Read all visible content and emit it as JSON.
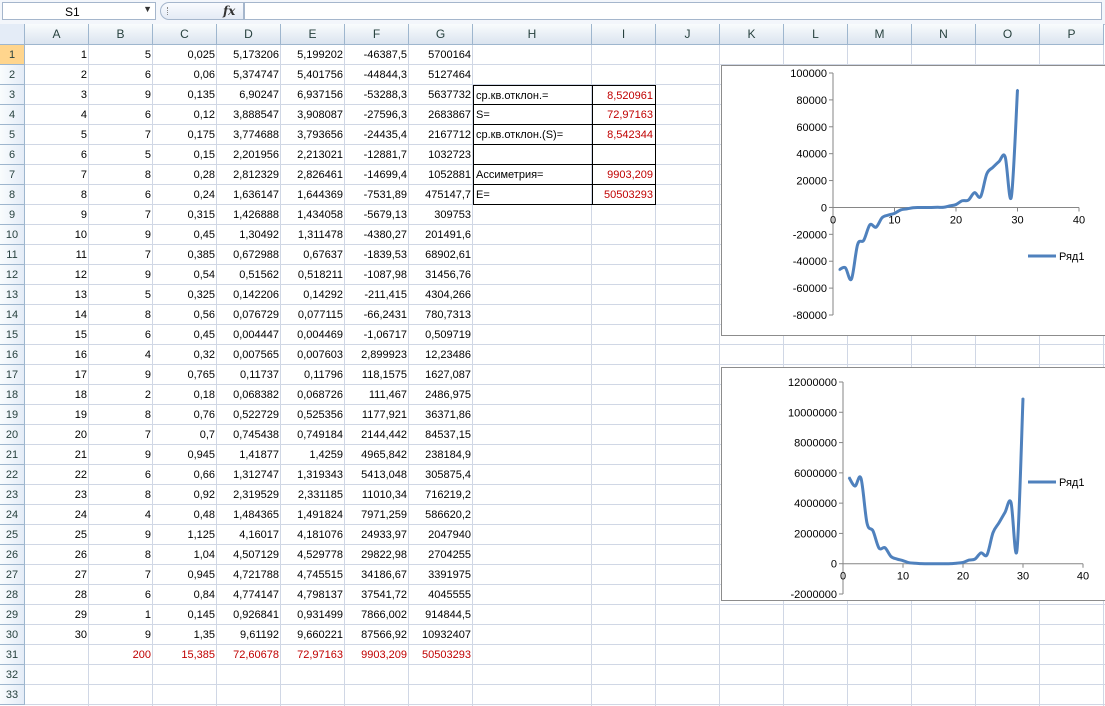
{
  "name_box": {
    "value": "S1"
  },
  "formula_bar": {
    "fx_label": "fx",
    "content": ""
  },
  "columns": [
    "A",
    "B",
    "C",
    "D",
    "E",
    "F",
    "G",
    "H",
    "I",
    "J",
    "K",
    "L",
    "M",
    "N",
    "O",
    "P"
  ],
  "rows": [
    "1",
    "2",
    "3",
    "4",
    "5",
    "6",
    "7",
    "8",
    "9",
    "10",
    "11",
    "12",
    "13",
    "14",
    "15",
    "16",
    "17",
    "18",
    "19",
    "20",
    "21",
    "22",
    "23",
    "24",
    "25",
    "26",
    "27",
    "28",
    "29",
    "30",
    "31",
    "32",
    "33"
  ],
  "table": [
    [
      "1",
      "5",
      "0,025",
      "5,173206",
      "5,199202",
      "-46387,5",
      "5700164"
    ],
    [
      "2",
      "6",
      "0,06",
      "5,374747",
      "5,401756",
      "-44844,3",
      "5127464"
    ],
    [
      "3",
      "9",
      "0,135",
      "6,90247",
      "6,937156",
      "-53288,3",
      "5637732"
    ],
    [
      "4",
      "6",
      "0,12",
      "3,888547",
      "3,908087",
      "-27596,3",
      "2683867"
    ],
    [
      "5",
      "7",
      "0,175",
      "3,774688",
      "3,793656",
      "-24435,4",
      "2167712"
    ],
    [
      "6",
      "5",
      "0,15",
      "2,201956",
      "2,213021",
      "-12881,7",
      "1032723"
    ],
    [
      "7",
      "8",
      "0,28",
      "2,812329",
      "2,826461",
      "-14699,4",
      "1052881"
    ],
    [
      "8",
      "6",
      "0,24",
      "1,636147",
      "1,644369",
      "-7531,89",
      "475147,7"
    ],
    [
      "9",
      "7",
      "0,315",
      "1,426888",
      "1,434058",
      "-5679,13",
      "309753"
    ],
    [
      "10",
      "9",
      "0,45",
      "1,30492",
      "1,311478",
      "-4380,27",
      "201491,6"
    ],
    [
      "11",
      "7",
      "0,385",
      "0,672988",
      "0,67637",
      "-1839,53",
      "68902,61"
    ],
    [
      "12",
      "9",
      "0,54",
      "0,51562",
      "0,518211",
      "-1087,98",
      "31456,76"
    ],
    [
      "13",
      "5",
      "0,325",
      "0,142206",
      "0,14292",
      "-211,415",
      "4304,266"
    ],
    [
      "14",
      "8",
      "0,56",
      "0,076729",
      "0,077115",
      "-66,2431",
      "780,7313"
    ],
    [
      "15",
      "6",
      "0,45",
      "0,004447",
      "0,004469",
      "-1,06717",
      "0,509719"
    ],
    [
      "16",
      "4",
      "0,32",
      "0,007565",
      "0,007603",
      "2,899923",
      "12,23486"
    ],
    [
      "17",
      "9",
      "0,765",
      "0,11737",
      "0,11796",
      "118,1575",
      "1627,087"
    ],
    [
      "18",
      "2",
      "0,18",
      "0,068382",
      "0,068726",
      "111,467",
      "2486,975"
    ],
    [
      "19",
      "8",
      "0,76",
      "0,522729",
      "0,525356",
      "1177,921",
      "36371,86"
    ],
    [
      "20",
      "7",
      "0,7",
      "0,745438",
      "0,749184",
      "2144,442",
      "84537,15"
    ],
    [
      "21",
      "9",
      "0,945",
      "1,41877",
      "1,4259",
      "4965,842",
      "238184,9"
    ],
    [
      "22",
      "6",
      "0,66",
      "1,312747",
      "1,319343",
      "5413,048",
      "305875,4"
    ],
    [
      "23",
      "8",
      "0,92",
      "2,319529",
      "2,331185",
      "11010,34",
      "716219,2"
    ],
    [
      "24",
      "4",
      "0,48",
      "1,484365",
      "1,491824",
      "7971,259",
      "586620,2"
    ],
    [
      "25",
      "9",
      "1,125",
      "4,16017",
      "4,181076",
      "24933,97",
      "2047940"
    ],
    [
      "26",
      "8",
      "1,04",
      "4,507129",
      "4,529778",
      "29822,98",
      "2704255"
    ],
    [
      "27",
      "7",
      "0,945",
      "4,721788",
      "4,745515",
      "34186,67",
      "3391975"
    ],
    [
      "28",
      "6",
      "0,84",
      "4,774147",
      "4,798137",
      "37541,72",
      "4045555"
    ],
    [
      "29",
      "1",
      "0,145",
      "0,926841",
      "0,931499",
      "7866,002",
      "914844,5"
    ],
    [
      "30",
      "9",
      "1,35",
      "9,61192",
      "9,660221",
      "87566,92",
      "10932407"
    ]
  ],
  "totals": [
    "",
    "200",
    "15,385",
    "72,60678",
    "72,97163",
    "9903,209",
    "50503293"
  ],
  "stats": [
    {
      "label": "ср.кв.отклон.=",
      "value": "8,520961"
    },
    {
      "label": "S=",
      "value": "72,97163"
    },
    {
      "label": "ср.кв.отклон.(S)=",
      "value": "8,542344"
    },
    {
      "label": "",
      "value": ""
    },
    {
      "label": "Ассиметрия=",
      "value": "9903,209"
    },
    {
      "label": "E=",
      "value": "50503293"
    }
  ],
  "colors": {
    "series": "#4f81bd",
    "red_text": "#c00000",
    "gridline": "#d0d7e5"
  },
  "chart_data": [
    {
      "type": "line",
      "series": [
        {
          "name": "Ряд1",
          "x": [
            1,
            2,
            3,
            4,
            5,
            6,
            7,
            8,
            9,
            10,
            11,
            12,
            13,
            14,
            15,
            16,
            17,
            18,
            19,
            20,
            21,
            22,
            23,
            24,
            25,
            26,
            27,
            28,
            29,
            30
          ],
          "values": [
            -46387.5,
            -44844.3,
            -53288.3,
            -27596.3,
            -24435.4,
            -12881.7,
            -14699.4,
            -7531.89,
            -5679.13,
            -4380.27,
            -1839.53,
            -1087.98,
            -211.415,
            -66.2431,
            -1.06717,
            2.899923,
            118.1575,
            111.467,
            1177.921,
            2144.442,
            4965.842,
            5413.048,
            11010.34,
            7971.259,
            24933.97,
            29822.98,
            34186.67,
            37541.72,
            7866.002,
            87566.92
          ]
        }
      ],
      "xlim": [
        0,
        40
      ],
      "ylim": [
        -80000,
        100000
      ],
      "xticks": [
        "0",
        "10",
        "20",
        "30",
        "40"
      ],
      "yticks": [
        "100000",
        "80000",
        "60000",
        "40000",
        "20000",
        "0",
        "-20000",
        "-40000",
        "-60000",
        "-80000"
      ],
      "legend": "right"
    },
    {
      "type": "line",
      "series": [
        {
          "name": "Ряд1",
          "x": [
            1,
            2,
            3,
            4,
            5,
            6,
            7,
            8,
            9,
            10,
            11,
            12,
            13,
            14,
            15,
            16,
            17,
            18,
            19,
            20,
            21,
            22,
            23,
            24,
            25,
            26,
            27,
            28,
            29,
            30
          ],
          "values": [
            5700164,
            5127464,
            5637732,
            2683867,
            2167712,
            1032723,
            1052881,
            475147.7,
            309753,
            201491.6,
            68902.61,
            31456.76,
            4304.266,
            780.7313,
            0.509719,
            12.23486,
            1627.087,
            2486.975,
            36371.86,
            84537.15,
            238184.9,
            305875.4,
            716219.2,
            586620.2,
            2047940,
            2704255,
            3391975,
            4045555,
            914844.5,
            10932407
          ]
        }
      ],
      "xlim": [
        0,
        40
      ],
      "ylim": [
        -2000000,
        12000000
      ],
      "xticks": [
        "0",
        "10",
        "20",
        "30",
        "40"
      ],
      "yticks": [
        "12000000",
        "10000000",
        "8000000",
        "6000000",
        "4000000",
        "2000000",
        "0",
        "-2000000"
      ],
      "legend": "right"
    }
  ]
}
